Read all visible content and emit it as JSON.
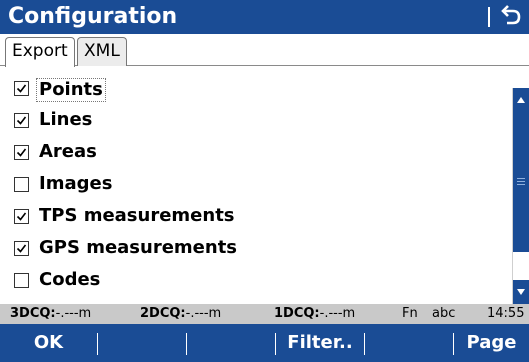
{
  "titlebar": {
    "title": "Configuration",
    "back_icon": "back-arrow-icon"
  },
  "tabs": [
    {
      "label": "Export",
      "active": true
    },
    {
      "label": "XML",
      "active": false
    }
  ],
  "items": [
    {
      "label": "Points",
      "checked": true,
      "focused": true
    },
    {
      "label": "Lines",
      "checked": true
    },
    {
      "label": "Areas",
      "checked": true
    },
    {
      "label": "Images",
      "checked": false
    },
    {
      "label": "TPS measurements",
      "checked": true
    },
    {
      "label": "GPS measurements",
      "checked": true
    },
    {
      "label": "Codes",
      "checked": false
    }
  ],
  "status": {
    "q3_label": "3DCQ:",
    "q3_value": "-.---m",
    "q2_label": "2DCQ:",
    "q2_value": "-.---m",
    "q1_label": "1DCQ:",
    "q1_value": "-.---m",
    "fn": "Fn",
    "input_mode": "abc",
    "time": "14:55"
  },
  "softkeys": {
    "ok": "OK",
    "filter": "Filter..",
    "page": "Page"
  },
  "colors": {
    "accent": "#1a4c95",
    "status_bg": "#c9c9c9"
  }
}
